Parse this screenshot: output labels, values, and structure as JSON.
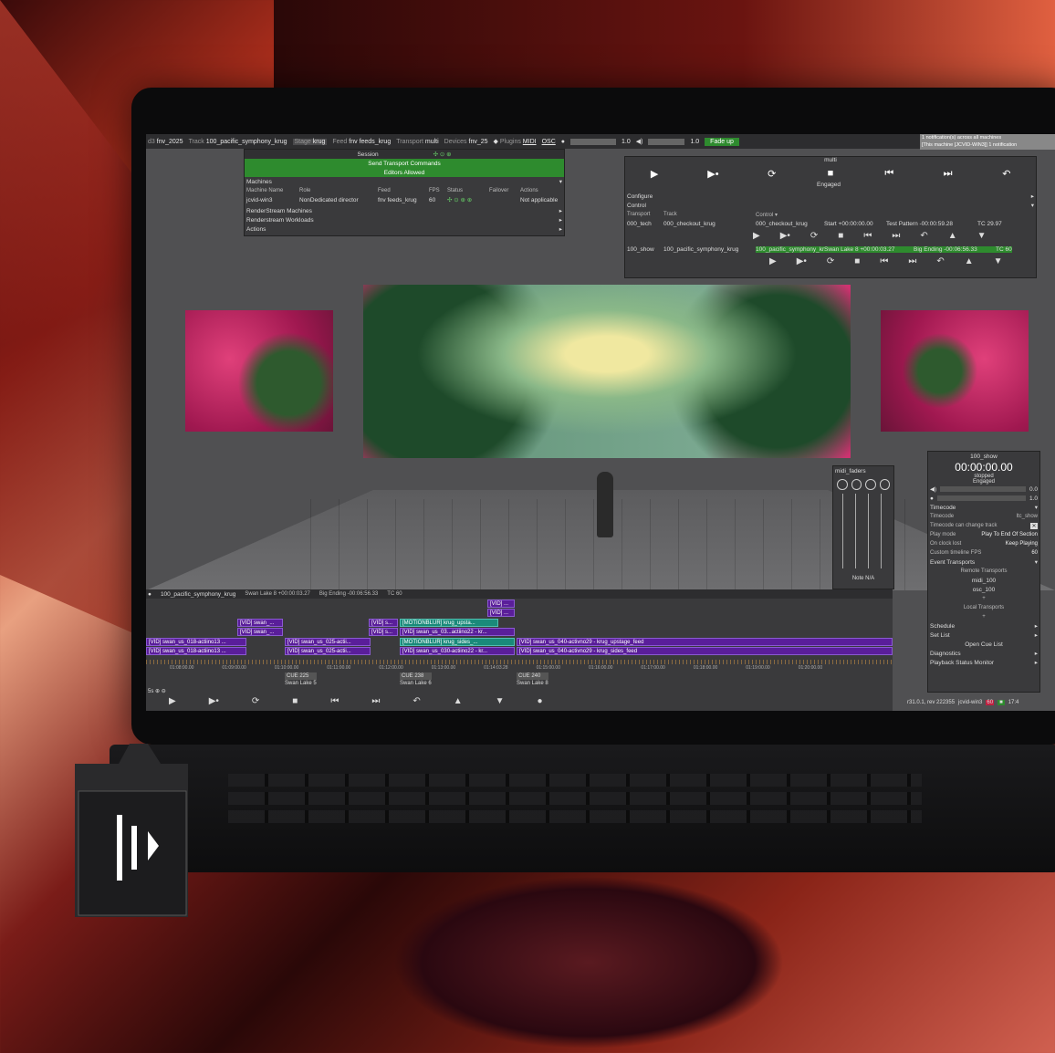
{
  "menubar": {
    "items": [
      {
        "k": "d3",
        "v": "fnv_2025"
      },
      {
        "k": "Track",
        "v": "100_pacific_symphony_krug"
      },
      {
        "k": "Stage",
        "v": "krug"
      },
      {
        "k": "Feed",
        "v": "fnv feeds_krug"
      },
      {
        "k": "Transport",
        "v": "multi"
      },
      {
        "k": "Devices",
        "v": "fnv_25"
      },
      {
        "k": "Plugins",
        "v": "MIDI"
      },
      {
        "k": "",
        "v": "OSC"
      }
    ],
    "val1": "1.0",
    "val2": "1.0",
    "fade": "Fade up",
    "notif1": "1 notification(s) across all machines",
    "notif2": "[This machine [JCVID-WIN3]] 1 notification"
  },
  "session": {
    "title": "Session",
    "send": "Send Transport Commands",
    "editors": "Editors Allowed",
    "machines": "Machines",
    "headers": [
      "Machine Name",
      "Role",
      "Feed",
      "FPS",
      "Status",
      "Failover",
      "Actions"
    ],
    "row": [
      "jcvid-win3",
      "NonDedicated director",
      "fnv feeds_krug",
      "60",
      "",
      "",
      "Not applicable"
    ],
    "items": [
      "RenderStream Machines",
      "Renderstream Workloads",
      "Actions"
    ]
  },
  "transport": {
    "title": "multi",
    "engaged": "Engaged",
    "configure": "Configure",
    "control": "Control",
    "h1": "Transport",
    "h2": "Track",
    "h3": "Control ▾",
    "r1": [
      "000_tech",
      "000_checkout_krug",
      "000_checkout_krug",
      "Start +00:00:00.00",
      "Test Pattern -00:00:59.28",
      "TC 29.97"
    ],
    "r2": [
      "100_show",
      "100_pacific_symphony_krug",
      "100_pacific_symphony_krug",
      "Swan Lake 8 +00:00:03.27",
      "Big Ending -00:06:56.33",
      "TC 60"
    ]
  },
  "midi": {
    "title": "midi_faders",
    "note": "Note N/A"
  },
  "show": {
    "title": "100_show",
    "time": "00:00:00.00",
    "stopped": "stopped",
    "engaged": "Engaged",
    "v1": "0.0",
    "v2": "1.0",
    "timecode": "Timecode",
    "rows": [
      [
        "Timecode",
        "ltc_show"
      ],
      [
        "Timecode can change track",
        ""
      ],
      [
        "Play mode",
        "Play To End Of Section"
      ],
      [
        "On clock lost",
        "Keep Playing"
      ],
      [
        "Custom timeline FPS",
        "60"
      ]
    ],
    "event": "Event Transports",
    "remote": "Remote Transports",
    "midi100": "midi_100",
    "osc100": "osc_100",
    "local": "Local Transports",
    "schedule": "Schedule",
    "setlist": "Set List",
    "opencue": "Open Cue List",
    "diag": "Diagnostics",
    "psm": "Playback Status Monitor"
  },
  "timeline": {
    "header": [
      "100_pacific_symphony_krug",
      "Swan Lake 8 +00:00:03.27",
      "Big Ending -00:06:56.33",
      "TC 60"
    ],
    "clips": [
      "[VID] swan_...",
      "[VID] swan_...",
      "[VID] s...",
      "[VID] s...",
      "[MOTIONBLUR] krug_upsta...",
      "[VID] ...",
      "[VID] ...",
      "[VID] swan_us_03...actiino22 - kr...",
      "[VID] swan_us_018-actiino13 ...",
      "[VID] swan_us_018-actiino13 ...",
      "[VID] swan_us_025-actii...",
      "[VID] swan_us_025-actii...",
      "[MOTIONBLUR] krug_sides_...",
      "[VID] swan_us_030-actiino22 - kr...",
      "[VID] swan_us_040-activno29 - krug_upstage_feed",
      "[VID] swan_us_040-activno29 - krug_sides_feed"
    ],
    "ticks": [
      "01:08:00.00",
      "01:09:00.00",
      "01:10:00.00",
      "01:11:00.00",
      "01:12:00.00",
      "01:13:00.00",
      "01:14:03.28",
      "01:15:00.00",
      "01:16:00.00",
      "01:17:00.00",
      "01:18:00.00",
      "01:19:00.00",
      "01:20:00.00"
    ],
    "cues": [
      [
        "CUE 225",
        "Swan Lake 5"
      ],
      [
        "CUE 238",
        "Swan Lake 6"
      ],
      [
        "CUE 240",
        "Swan Lake 8"
      ]
    ],
    "zoom": "5s",
    "status": "r31.0.1, rev 222355",
    "machine": "jcvid-win3",
    "fps": "60",
    "time": "17:4"
  },
  "icons": {
    "app": "disguise-icon"
  }
}
